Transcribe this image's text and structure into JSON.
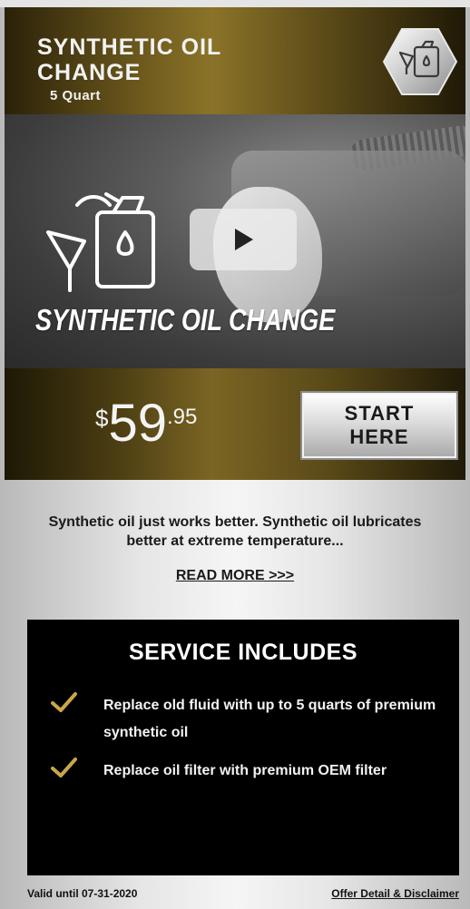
{
  "header": {
    "title": "SYNTHETIC OIL CHANGE",
    "subtitle": "5 Quart",
    "badge_icon": "oil-can-funnel-icon"
  },
  "video": {
    "caption": "SYNTHETIC OIL CHANGE",
    "play_icon": "play-icon",
    "art_icon": "oil-can-funnel-icon"
  },
  "price": {
    "currency": "$",
    "whole": "59",
    "fraction": ".95"
  },
  "start_button": {
    "label_line1": "START",
    "label_line2": "HERE"
  },
  "description": {
    "text": "Synthetic oil just works better. Synthetic oil lubricates better at extreme temperature...",
    "read_more": "READ MORE >>>"
  },
  "includes": {
    "title": "SERVICE INCLUDES",
    "items": [
      {
        "text": "Replace old fluid with up to 5 quarts of premium synthetic oil",
        "icon": "check-icon"
      },
      {
        "text": "Replace oil filter with premium OEM filter",
        "icon": "check-icon"
      }
    ]
  },
  "footer": {
    "valid": "Valid until 07-31-2020",
    "disclaimer": "Offer Detail & Disclaimer"
  },
  "colors": {
    "gold": "#c9a64a",
    "dark_gold": "#5b4a18",
    "black": "#000000"
  }
}
